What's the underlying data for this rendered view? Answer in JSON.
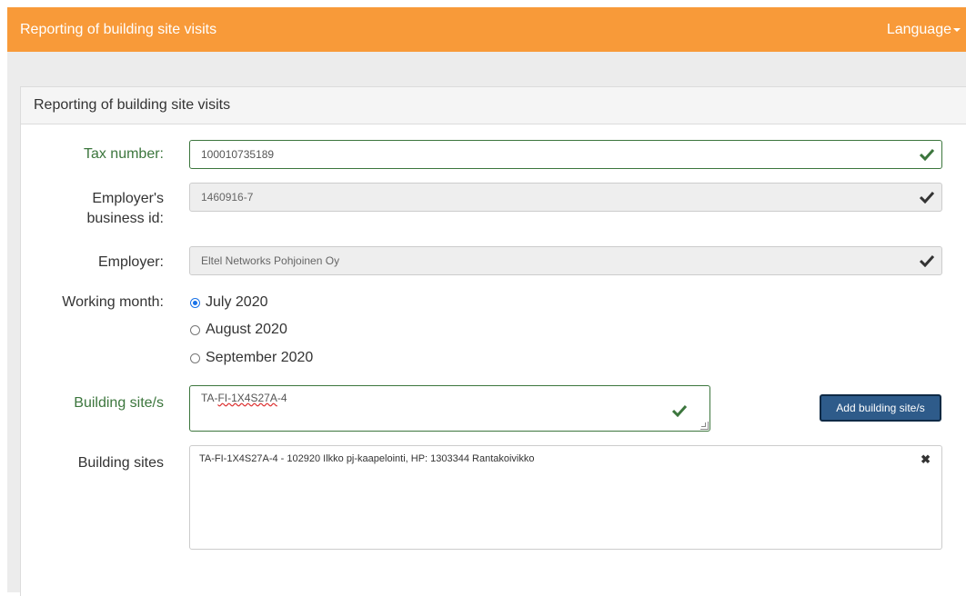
{
  "header": {
    "app_title": "Reporting of building site visits",
    "language_label": "Language",
    "bg_color": "#f89a39"
  },
  "panel": {
    "title": "Reporting of building site visits"
  },
  "form": {
    "tax_number": {
      "label": "Tax number:",
      "value": "100010735189"
    },
    "business_id": {
      "label_line1": "Employer's",
      "label_line2": "business id:",
      "value": "1460916-7"
    },
    "employer": {
      "label": "Employer:",
      "value": "Eltel Networks Pohjoinen Oy"
    },
    "working_month": {
      "label": "Working month:",
      "options": [
        "July 2020",
        "August 2020",
        "September 2020"
      ],
      "selected": "July 2020"
    },
    "building_site": {
      "label": "Building site/s",
      "value_prefix": "TA-",
      "value_underlined": "FI-1X4S27A",
      "value_suffix": "-4",
      "add_button": "Add building site/s"
    },
    "building_sites": {
      "label": "Building sites",
      "items": [
        "TA-FI-1X4S27A-4 - 102920 Ilkko pj-kaapelointi, HP: 1303344 Rantakoivikko"
      ]
    }
  },
  "icons": {
    "valid": "check-icon",
    "remove": "close-icon",
    "dropdown": "caret-down-icon"
  },
  "colors": {
    "valid_green": "#3c763d",
    "button_blue": "#2e5b8a"
  }
}
